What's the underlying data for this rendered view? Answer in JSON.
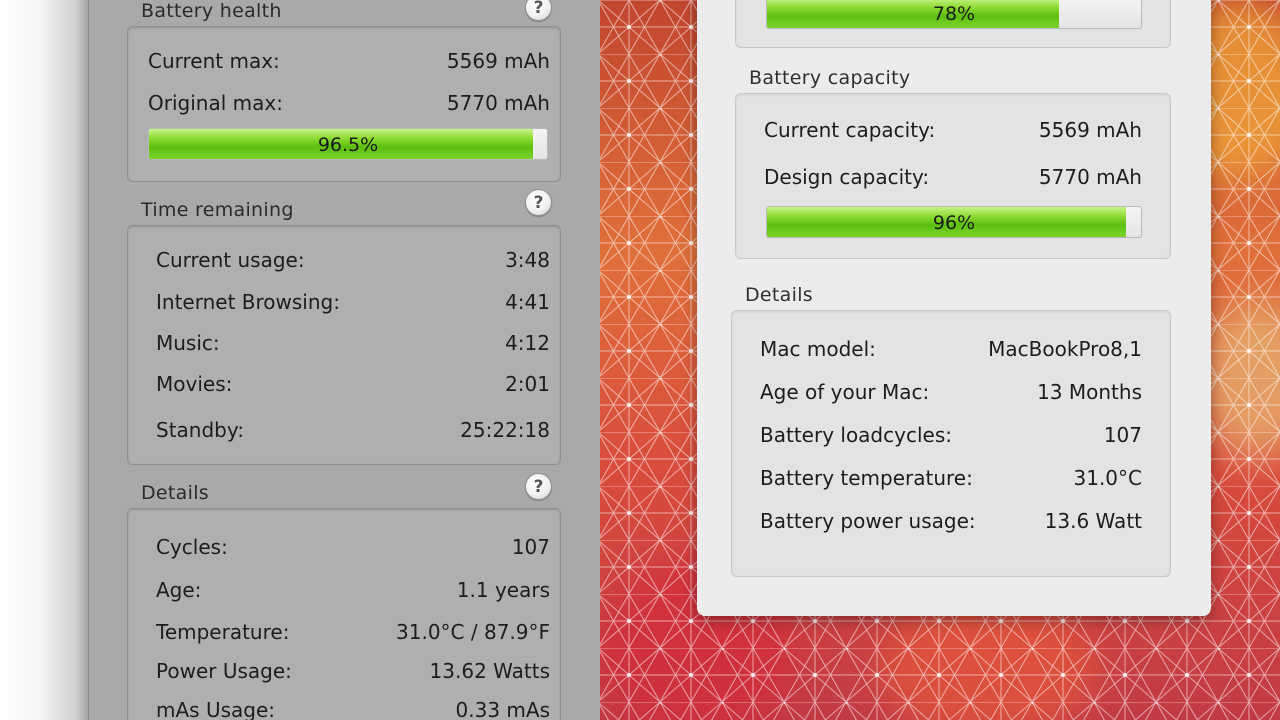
{
  "left_panel": {
    "battery_health": {
      "title": "Battery health",
      "help": "?",
      "rows": [
        {
          "label": "Current max:",
          "value": "5569 mAh"
        },
        {
          "label": "Original max:",
          "value": "5770 mAh"
        }
      ],
      "progress": {
        "label": "96.5%",
        "percent": 96.5
      }
    },
    "time_remaining": {
      "title": "Time remaining",
      "help": "?",
      "rows": [
        {
          "label": "Current usage:",
          "value": "3:48"
        },
        {
          "label": "Internet Browsing:",
          "value": "4:41"
        },
        {
          "label": "Music:",
          "value": "4:12"
        },
        {
          "label": "Movies:",
          "value": "2:01"
        },
        {
          "label": "Standby:",
          "value": "25:22:18"
        }
      ]
    },
    "details": {
      "title": "Details",
      "help": "?",
      "rows": [
        {
          "label": "Cycles:",
          "value": "107"
        },
        {
          "label": "Age:",
          "value": "1.1 years"
        },
        {
          "label": "Temperature:",
          "value": "31.0°C / 87.9°F"
        },
        {
          "label": "Power Usage:",
          "value": "13.62 Watts"
        },
        {
          "label": "mAs Usage:",
          "value": "0.33 mAs"
        }
      ]
    }
  },
  "right_panel": {
    "top_progress": {
      "label": "78%",
      "percent": 78
    },
    "battery_capacity": {
      "title": "Battery capacity",
      "rows": [
        {
          "label": "Current capacity:",
          "value": "5569 mAh"
        },
        {
          "label": "Design capacity:",
          "value": "5770 mAh"
        }
      ],
      "progress": {
        "label": "96%",
        "percent": 96
      }
    },
    "details": {
      "title": "Details",
      "rows": [
        {
          "label": "Mac model:",
          "value": "MacBookPro8,1"
        },
        {
          "label": "Age of your Mac:",
          "value": "13 Months"
        },
        {
          "label": "Battery loadcycles:",
          "value": "107"
        },
        {
          "label": "Battery temperature:",
          "value": "31.0°C"
        },
        {
          "label": "Battery power usage:",
          "value": "13.6 Watt"
        }
      ]
    }
  },
  "colors": {
    "bar_green": "#5cbf0f",
    "left_panel_bg": "#a9a9a9",
    "right_panel_bg": "#ececec",
    "wallpaper_red": "#d94b3c",
    "wallpaper_orange": "#e0703a"
  },
  "icons": {
    "help": "question-mark-circle-icon"
  }
}
